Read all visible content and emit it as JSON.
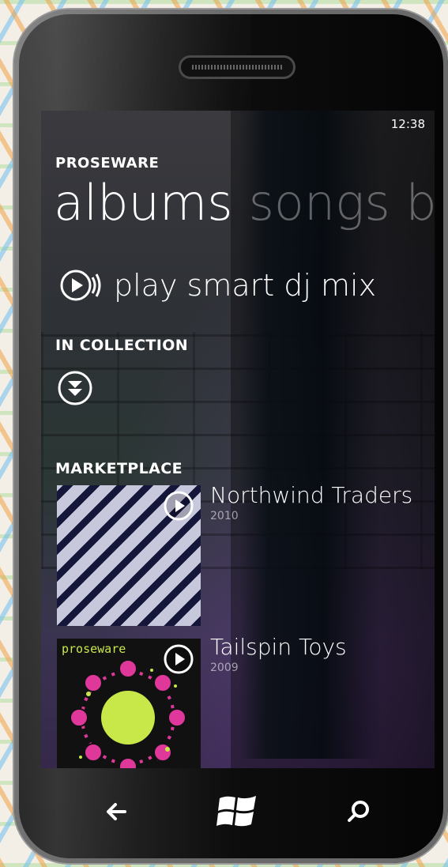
{
  "status": {
    "time": "12:38"
  },
  "app": {
    "title": "PROSEWARE"
  },
  "pivot": {
    "active": "albums",
    "next": "songs b"
  },
  "actions": {
    "smart_dj": "play smart dj mix"
  },
  "sections": {
    "collection": "IN COLLECTION",
    "marketplace": "MARKETPLACE"
  },
  "albums": [
    {
      "title": "Northwind Traders",
      "year": "2010"
    },
    {
      "title": "Tailspin Toys",
      "year": "2009",
      "cover_text": "proseware"
    }
  ],
  "hardware": {
    "back_icon": "back-arrow-icon",
    "start_icon": "windows-logo-icon",
    "search_icon": "search-icon"
  },
  "colors": {
    "accent": "#ffffff",
    "cover_pink": "#e0389a",
    "cover_green": "#c8e84a"
  }
}
